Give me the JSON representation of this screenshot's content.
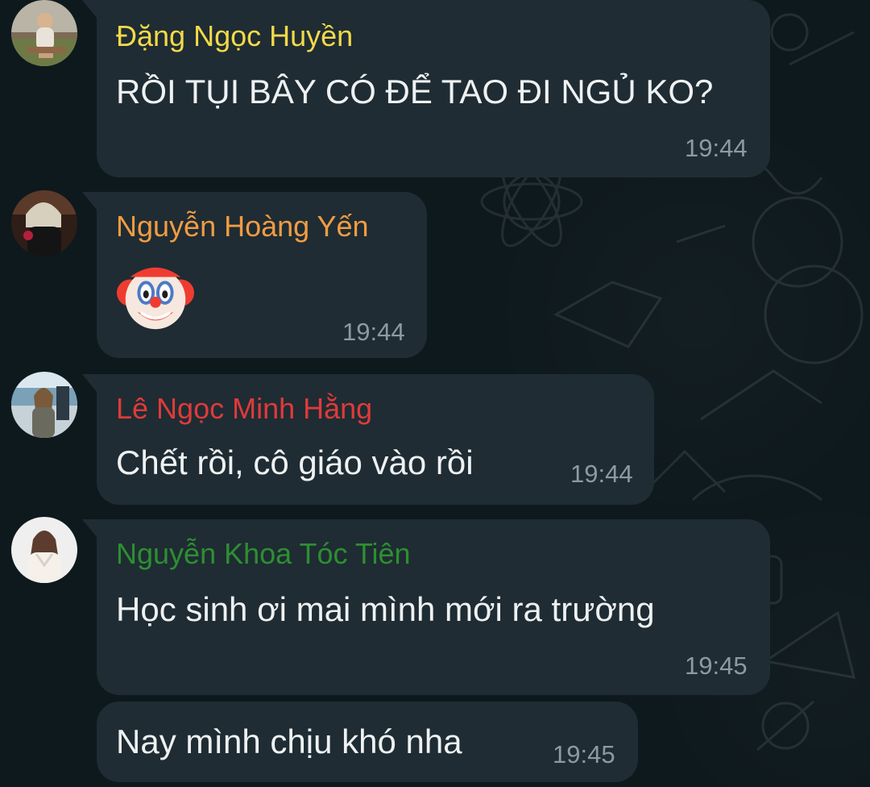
{
  "colors": {
    "background": "#0e191d",
    "bubble": "#1f2c33",
    "sender_1": "#f3d94a",
    "sender_2": "#f29c43",
    "sender_3": "#e03a3a",
    "sender_4": "#2d8f31",
    "timestamp": "#8d9aa1",
    "message_text": "#eef1f2"
  },
  "messages": [
    {
      "sender": "Đặng Ngọc Huyền",
      "text": "RỒI TỤI BÂY CÓ ĐỂ TAO ĐI NGỦ KO?",
      "time": "19:44",
      "avatar_icon": "avatar-photo-1"
    },
    {
      "sender": "Nguyễn Hoàng Yến",
      "emoji": "clown-face-icon",
      "time": "19:44",
      "avatar_icon": "avatar-photo-2"
    },
    {
      "sender": "Lê Ngọc Minh Hằng",
      "text": "Chết rồi, cô giáo vào rồi",
      "time": "19:44",
      "avatar_icon": "avatar-photo-3"
    },
    {
      "sender": "Nguyễn Khoa Tóc Tiên",
      "text": "Học sinh ơi mai mình mới ra trường",
      "time": "19:45",
      "avatar_icon": "avatar-photo-4"
    },
    {
      "text": "Nay mình chịu khó nha",
      "time": "19:45"
    }
  ]
}
